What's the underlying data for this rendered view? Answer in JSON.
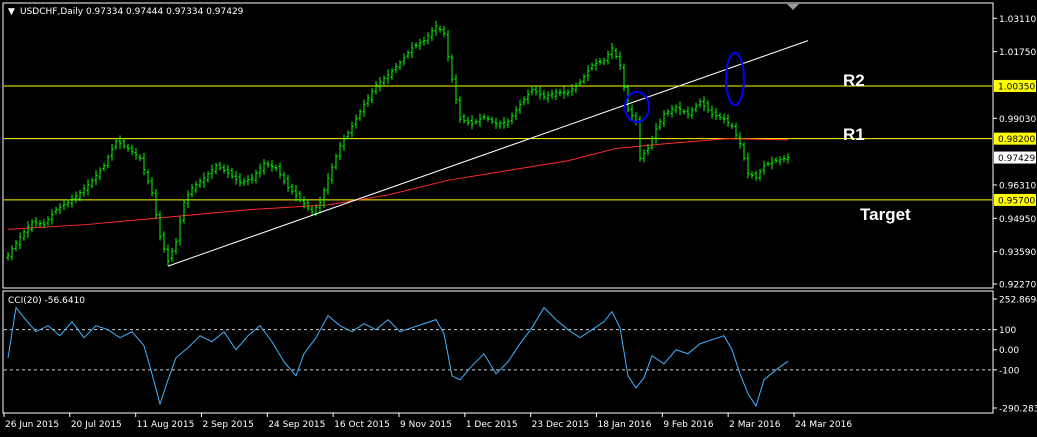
{
  "window": {
    "header": "USDCHF,Daily  0.97334 0.97444 0.97334 0.97429",
    "cci_header": "CCI(20) -56.6410",
    "menu_glyph": "▼"
  },
  "colors": {
    "background": "#000000",
    "frame": "#ffffff",
    "candle": "#00ff00",
    "moving_average": "#ff2a2a",
    "horizontal_levels": "#ffff00",
    "trendline": "#ffffff",
    "highlight_ellipse": "#0000ff",
    "cci_line": "#3fb4ff",
    "cci_levels": "#cfcfcf",
    "price_marker_bg": "#ffff00",
    "price_marker_text": "#000000",
    "current_marker_bg": "#ffffff"
  },
  "chart_data": [
    {
      "type": "candlestick",
      "symbol": "USDCHF",
      "timeframe": "Daily",
      "ohlc_last": {
        "open": 0.97334,
        "high": 0.97444,
        "low": 0.97334,
        "close": 0.97429
      },
      "ylim": [
        0.9227,
        1.0353
      ],
      "yticks": [
        1.0311,
        1.0175,
        1.0035,
        0.9903,
        0.982,
        0.97429,
        0.9631,
        0.957,
        0.9495,
        0.9359,
        0.9227
      ],
      "ytick_labels": [
        "1.03110",
        "1.01750",
        "1.00350",
        "0.99030",
        "0.98200",
        "0.97429",
        "0.96310",
        "0.95700",
        "0.94950",
        "0.93590",
        "0.92270"
      ],
      "xticks": [
        "26 Jun 2015",
        "20 Jul 2015",
        "11 Aug 2015",
        "2 Sep 2015",
        "24 Sep 2015",
        "16 Oct 2015",
        "9 Nov 2015",
        "1 Dec 2015",
        "23 Dec 2015",
        "18 Jan 2016",
        "9 Feb 2016",
        "2 Mar 2016",
        "24 Mar 2016"
      ],
      "close_path": [
        [
          0,
          0.9345
        ],
        [
          3,
          0.942
        ],
        [
          6,
          0.948
        ],
        [
          9,
          0.947
        ],
        [
          12,
          0.953
        ],
        [
          15,
          0.956
        ],
        [
          18,
          0.96
        ],
        [
          21,
          0.965
        ],
        [
          24,
          0.971
        ],
        [
          27,
          0.981
        ],
        [
          30,
          0.978
        ],
        [
          33,
          0.974
        ],
        [
          36,
          0.96
        ],
        [
          38,
          0.942
        ],
        [
          40,
          0.932
        ],
        [
          42,
          0.94
        ],
        [
          44,
          0.956
        ],
        [
          46,
          0.962
        ],
        [
          49,
          0.966
        ],
        [
          52,
          0.971
        ],
        [
          55,
          0.968
        ],
        [
          58,
          0.964
        ],
        [
          61,
          0.966
        ],
        [
          64,
          0.972
        ],
        [
          67,
          0.97
        ],
        [
          70,
          0.962
        ],
        [
          73,
          0.957
        ],
        [
          76,
          0.952
        ],
        [
          78,
          0.956
        ],
        [
          80,
          0.966
        ],
        [
          83,
          0.979
        ],
        [
          86,
          0.987
        ],
        [
          89,
          0.996
        ],
        [
          92,
          1.004
        ],
        [
          95,
          1.008
        ],
        [
          98,
          1.013
        ],
        [
          101,
          1.019
        ],
        [
          104,
          1.022
        ],
        [
          107,
          1.028
        ],
        [
          109,
          1.025
        ],
        [
          111,
          1.006
        ],
        [
          113,
          0.99
        ],
        [
          116,
          0.988
        ],
        [
          119,
          0.991
        ],
        [
          122,
          0.988
        ],
        [
          125,
          0.989
        ],
        [
          128,
          0.996
        ],
        [
          131,
          1.002
        ],
        [
          134,
          0.999
        ],
        [
          137,
          1.001
        ],
        [
          140,
          1.001
        ],
        [
          143,
          1.005
        ],
        [
          146,
          1.012
        ],
        [
          149,
          1.014
        ],
        [
          151,
          1.019
        ],
        [
          153,
          1.012
        ],
        [
          155,
          0.994
        ],
        [
          157,
          0.989
        ],
        [
          158,
          0.974
        ],
        [
          160,
          0.978
        ],
        [
          162,
          0.986
        ],
        [
          164,
          0.992
        ],
        [
          167,
          0.995
        ],
        [
          170,
          0.992
        ],
        [
          173,
          0.997
        ],
        [
          176,
          0.992
        ],
        [
          179,
          0.99
        ],
        [
          181,
          0.987
        ],
        [
          183,
          0.98
        ],
        [
          185,
          0.968
        ],
        [
          187,
          0.966
        ],
        [
          189,
          0.971
        ],
        [
          192,
          0.973
        ],
        [
          195,
          0.9743
        ]
      ],
      "moving_average": [
        [
          0,
          0.945
        ],
        [
          20,
          0.947
        ],
        [
          40,
          0.95
        ],
        [
          60,
          0.953
        ],
        [
          80,
          0.955
        ],
        [
          95,
          0.959
        ],
        [
          110,
          0.965
        ],
        [
          125,
          0.969
        ],
        [
          140,
          0.973
        ],
        [
          152,
          0.978
        ],
        [
          165,
          0.98
        ],
        [
          180,
          0.982
        ],
        [
          195,
          0.9815
        ]
      ],
      "horizontal_levels": [
        1.0035,
        0.982,
        0.957
      ],
      "level_labels": [
        "R2",
        "R1",
        "Target"
      ],
      "trendline": {
        "from": [
          40,
          0.93
        ],
        "to": [
          200,
          1.022
        ]
      }
    },
    {
      "type": "line",
      "name": "CCI(20)",
      "last_value": -56.641,
      "ylim": [
        -290.2834,
        252.8694
      ],
      "yticks": [
        252.8694,
        100,
        0,
        -100,
        -290.2834
      ],
      "ytick_labels": [
        "252.8694",
        "100",
        "0.00",
        "-100",
        "-290.2834"
      ],
      "levels": [
        100,
        -100
      ],
      "series": [
        [
          0,
          -40
        ],
        [
          2,
          210
        ],
        [
          4,
          160
        ],
        [
          7,
          90
        ],
        [
          10,
          120
        ],
        [
          13,
          70
        ],
        [
          16,
          140
        ],
        [
          19,
          60
        ],
        [
          22,
          120
        ],
        [
          25,
          100
        ],
        [
          28,
          60
        ],
        [
          31,
          90
        ],
        [
          34,
          20
        ],
        [
          36,
          -120
        ],
        [
          38,
          -270
        ],
        [
          40,
          -150
        ],
        [
          42,
          -40
        ],
        [
          45,
          10
        ],
        [
          48,
          70
        ],
        [
          51,
          40
        ],
        [
          54,
          90
        ],
        [
          57,
          0
        ],
        [
          60,
          70
        ],
        [
          63,
          120
        ],
        [
          66,
          40
        ],
        [
          69,
          -60
        ],
        [
          72,
          -130
        ],
        [
          74,
          -20
        ],
        [
          77,
          60
        ],
        [
          80,
          170
        ],
        [
          83,
          120
        ],
        [
          86,
          90
        ],
        [
          89,
          130
        ],
        [
          92,
          100
        ],
        [
          95,
          150
        ],
        [
          98,
          90
        ],
        [
          101,
          110
        ],
        [
          104,
          130
        ],
        [
          107,
          150
        ],
        [
          109,
          80
        ],
        [
          111,
          -130
        ],
        [
          113,
          -150
        ],
        [
          116,
          -80
        ],
        [
          119,
          -20
        ],
        [
          122,
          -120
        ],
        [
          125,
          -60
        ],
        [
          128,
          30
        ],
        [
          131,
          110
        ],
        [
          134,
          210
        ],
        [
          137,
          150
        ],
        [
          140,
          100
        ],
        [
          143,
          60
        ],
        [
          146,
          100
        ],
        [
          149,
          140
        ],
        [
          151,
          190
        ],
        [
          153,
          110
        ],
        [
          155,
          -130
        ],
        [
          157,
          -190
        ],
        [
          159,
          -140
        ],
        [
          161,
          -30
        ],
        [
          164,
          -70
        ],
        [
          167,
          0
        ],
        [
          170,
          -20
        ],
        [
          173,
          30
        ],
        [
          176,
          50
        ],
        [
          179,
          70
        ],
        [
          181,
          0
        ],
        [
          183,
          -120
        ],
        [
          185,
          -220
        ],
        [
          187,
          -280
        ],
        [
          189,
          -150
        ],
        [
          192,
          -100
        ],
        [
          195,
          -57
        ]
      ]
    }
  ]
}
